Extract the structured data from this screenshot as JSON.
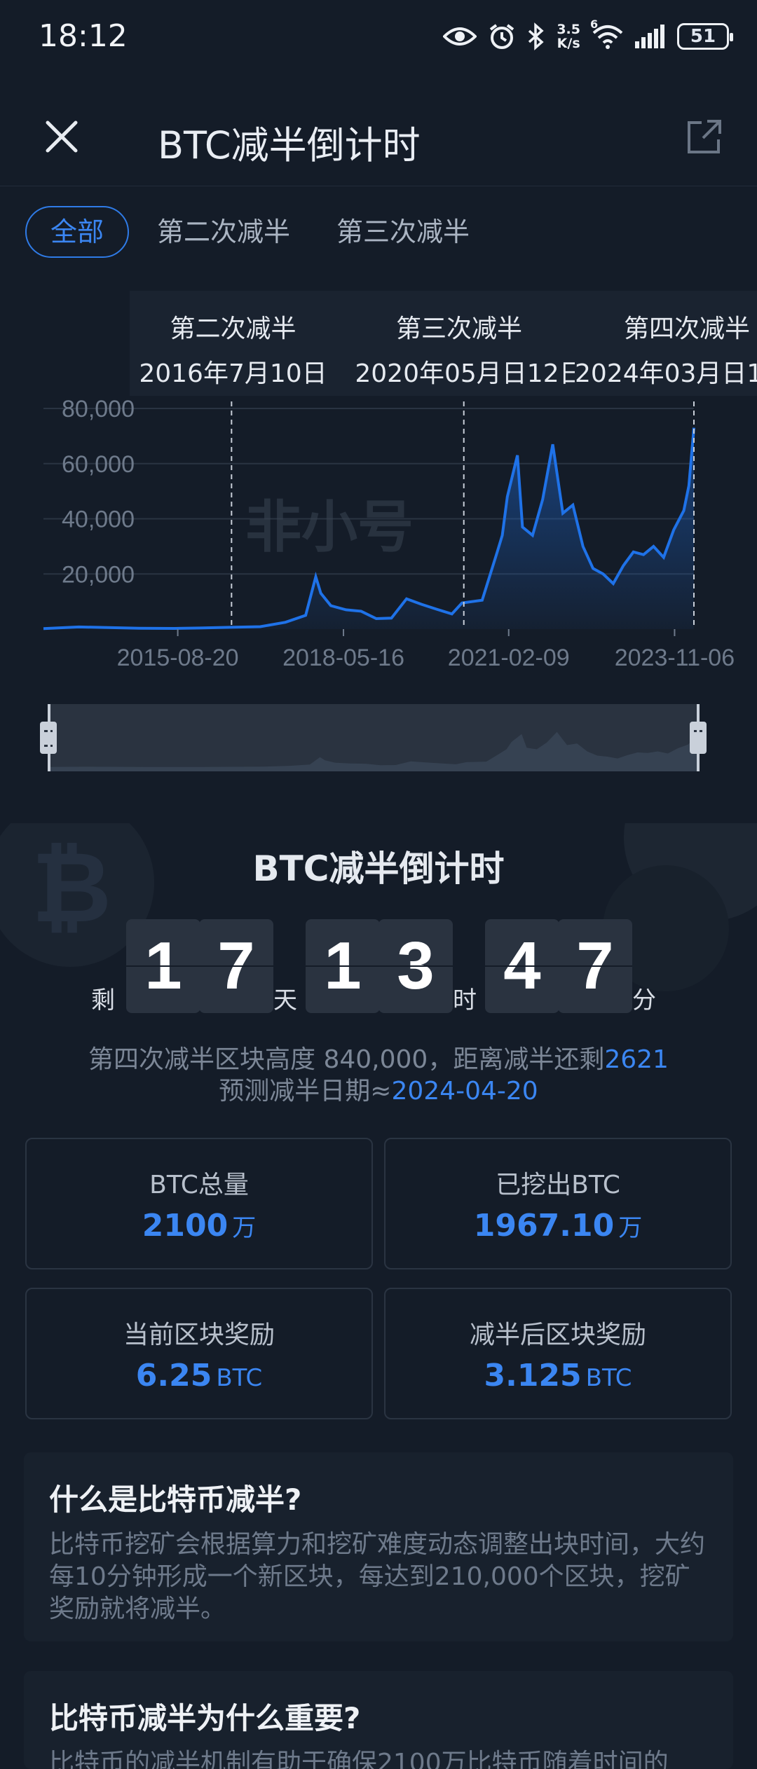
{
  "status_bar": {
    "time": "18:12",
    "net_speed_top": "3.5",
    "net_speed_bottom": "K/s",
    "wifi_label": "6",
    "battery": "51"
  },
  "header": {
    "title": "BTC减半倒计时"
  },
  "tabs": [
    {
      "label": "全部",
      "active": true
    },
    {
      "label": "第二次减半",
      "active": false
    },
    {
      "label": "第三次减半",
      "active": false
    }
  ],
  "chart_data": {
    "type": "area",
    "title": "",
    "xlabel": "",
    "ylabel": "",
    "ylim": [
      0,
      80000
    ],
    "y_ticks": [
      "80,000",
      "60,000",
      "40,000",
      "20,000"
    ],
    "x_ticks": [
      "2015-08-20",
      "2018-05-16",
      "2021-02-09",
      "2023-11-06"
    ],
    "watermark": "非小号",
    "color": "#1f72e8",
    "halvings": [
      {
        "name": "第二次减半",
        "date": "2016年7月10日"
      },
      {
        "name": "第三次减半",
        "date": "2020年05月日12日"
      },
      {
        "name": "第四次减半",
        "date": "2024年03月日1"
      }
    ],
    "series": [
      {
        "x": [
          "2013-06",
          "2014-01",
          "2014-06",
          "2015-01",
          "2015-08",
          "2016-01",
          "2016-07",
          "2017-01",
          "2017-06",
          "2017-10",
          "2017-12",
          "2018-01",
          "2018-03",
          "2018-06",
          "2018-09",
          "2018-12",
          "2019-03",
          "2019-06",
          "2019-09",
          "2019-12",
          "2020-03",
          "2020-05",
          "2020-09",
          "2020-12",
          "2021-01",
          "2021-02",
          "2021-04",
          "2021-05",
          "2021-07",
          "2021-09",
          "2021-11",
          "2022-01",
          "2022-03",
          "2022-05",
          "2022-07",
          "2022-09",
          "2022-11",
          "2023-01",
          "2023-03",
          "2023-05",
          "2023-07",
          "2023-09",
          "2023-11",
          "2024-01",
          "2024-02",
          "2024-03"
        ],
        "y": [
          200,
          800,
          600,
          300,
          250,
          400,
          650,
          900,
          2500,
          5000,
          19000,
          13000,
          8500,
          7000,
          6500,
          3800,
          4000,
          11000,
          9000,
          7200,
          5500,
          9500,
          10500,
          28000,
          34000,
          48000,
          63000,
          37000,
          34000,
          47000,
          67000,
          42000,
          45000,
          30000,
          22000,
          20000,
          16500,
          23000,
          28000,
          27000,
          30000,
          26000,
          36000,
          43000,
          52000,
          73000
        ]
      }
    ]
  },
  "countdown": {
    "title": "BTC减半倒计时",
    "prefix": "剩",
    "days": [
      "1",
      "7"
    ],
    "days_unit": "天",
    "hours": [
      "1",
      "3"
    ],
    "hours_unit": "时",
    "minutes": [
      "4",
      "7"
    ],
    "minutes_unit": "分",
    "info_line1": "第四次减半区块高度 840,000，距离减半还剩",
    "blocks_left": "2621",
    "info_line2": "预测减半日期≈",
    "predicted_date": "2024-04-20"
  },
  "stats": [
    {
      "label": "BTC总量",
      "value": "2100",
      "unit": "万"
    },
    {
      "label": "已挖出BTC",
      "value": "1967.10",
      "unit": "万"
    },
    {
      "label": "当前区块奖励",
      "value": "6.25",
      "unit": "BTC"
    },
    {
      "label": "减半后区块奖励",
      "value": "3.125",
      "unit": "BTC"
    }
  ],
  "faq": [
    {
      "question": "什么是比特币减半?",
      "answer": "比特币挖矿会根据算力和挖矿难度动态调整出块时间，大约每10分钟形成一个新区块，每达到210,000个区块，挖矿奖励就将减半。"
    },
    {
      "question": "比特币减半为什么重要?",
      "answer": "比特币的减半机制有助于确保2100万比特币随着时间的"
    }
  ]
}
